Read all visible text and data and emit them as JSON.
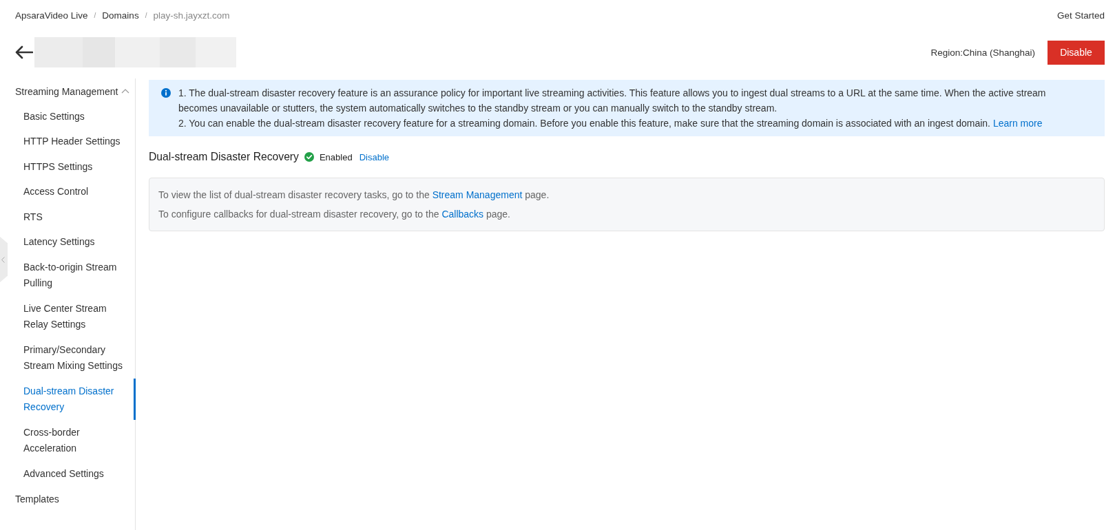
{
  "breadcrumb": [
    {
      "kind": "link",
      "label": "ApsaraVideo Live"
    },
    {
      "kind": "separator",
      "label": "/"
    },
    {
      "kind": "link",
      "label": "Domains"
    },
    {
      "kind": "separator",
      "label": "/"
    },
    {
      "kind": "current",
      "label": "play-sh.jayxzt.com"
    }
  ],
  "header": {
    "get_started": "Get Started",
    "region": "Region:China (Shanghai)",
    "disable_button": "Disable"
  },
  "sidebar": {
    "groups": [
      {
        "label": "Streaming Management",
        "selected": false,
        "expanded": true,
        "children": [
          {
            "label": "Basic Settings",
            "selected": false
          },
          {
            "label": "HTTP Header Settings",
            "selected": false
          },
          {
            "label": "HTTPS Settings",
            "selected": false
          },
          {
            "label": "Access Control",
            "selected": false
          },
          {
            "label": "RTS",
            "selected": false
          },
          {
            "label": "Latency Settings",
            "selected": false
          },
          {
            "label": "Back-to-origin Stream Pulling",
            "selected": false
          },
          {
            "label": "Live Center Stream Relay Settings",
            "selected": false
          },
          {
            "label": "Primary/Secondary Stream Mixing Settings",
            "selected": false
          },
          {
            "label": "Dual-stream Disaster Recovery",
            "selected": true
          },
          {
            "label": "Cross-border Acceleration",
            "selected": false
          },
          {
            "label": "Advanced Settings",
            "selected": false
          }
        ]
      },
      {
        "label": "Templates",
        "selected": false
      }
    ]
  },
  "notice": {
    "items": [
      {
        "text": "1. The dual-stream disaster recovery feature is an assurance policy for important live streaming activities. This feature allows you to ingest dual streams to a URL at the same time. When the active stream becomes unavailable or stutters, the system automatically switches to the standby stream or you can manually switch to the standby stream."
      },
      {
        "text": "2. You can enable the dual-stream disaster recovery feature for a streaming domain. Before you enable this feature, make sure that the streaming domain is associated with an ingest domain.",
        "link": "Learn more"
      }
    ]
  },
  "status_row": {
    "title": "Dual-stream Disaster Recovery",
    "status": {
      "label": "Enabled",
      "enabled": true
    },
    "action_link": "Disable"
  },
  "tips": [
    {
      "before": "To view the list of dual-stream disaster recovery tasks, go to the",
      "link": "Stream Management",
      "after": "page."
    },
    {
      "before": "To configure callbacks for dual-stream disaster recovery, go to the",
      "link": "Callbacks",
      "after": "page."
    }
  ]
}
